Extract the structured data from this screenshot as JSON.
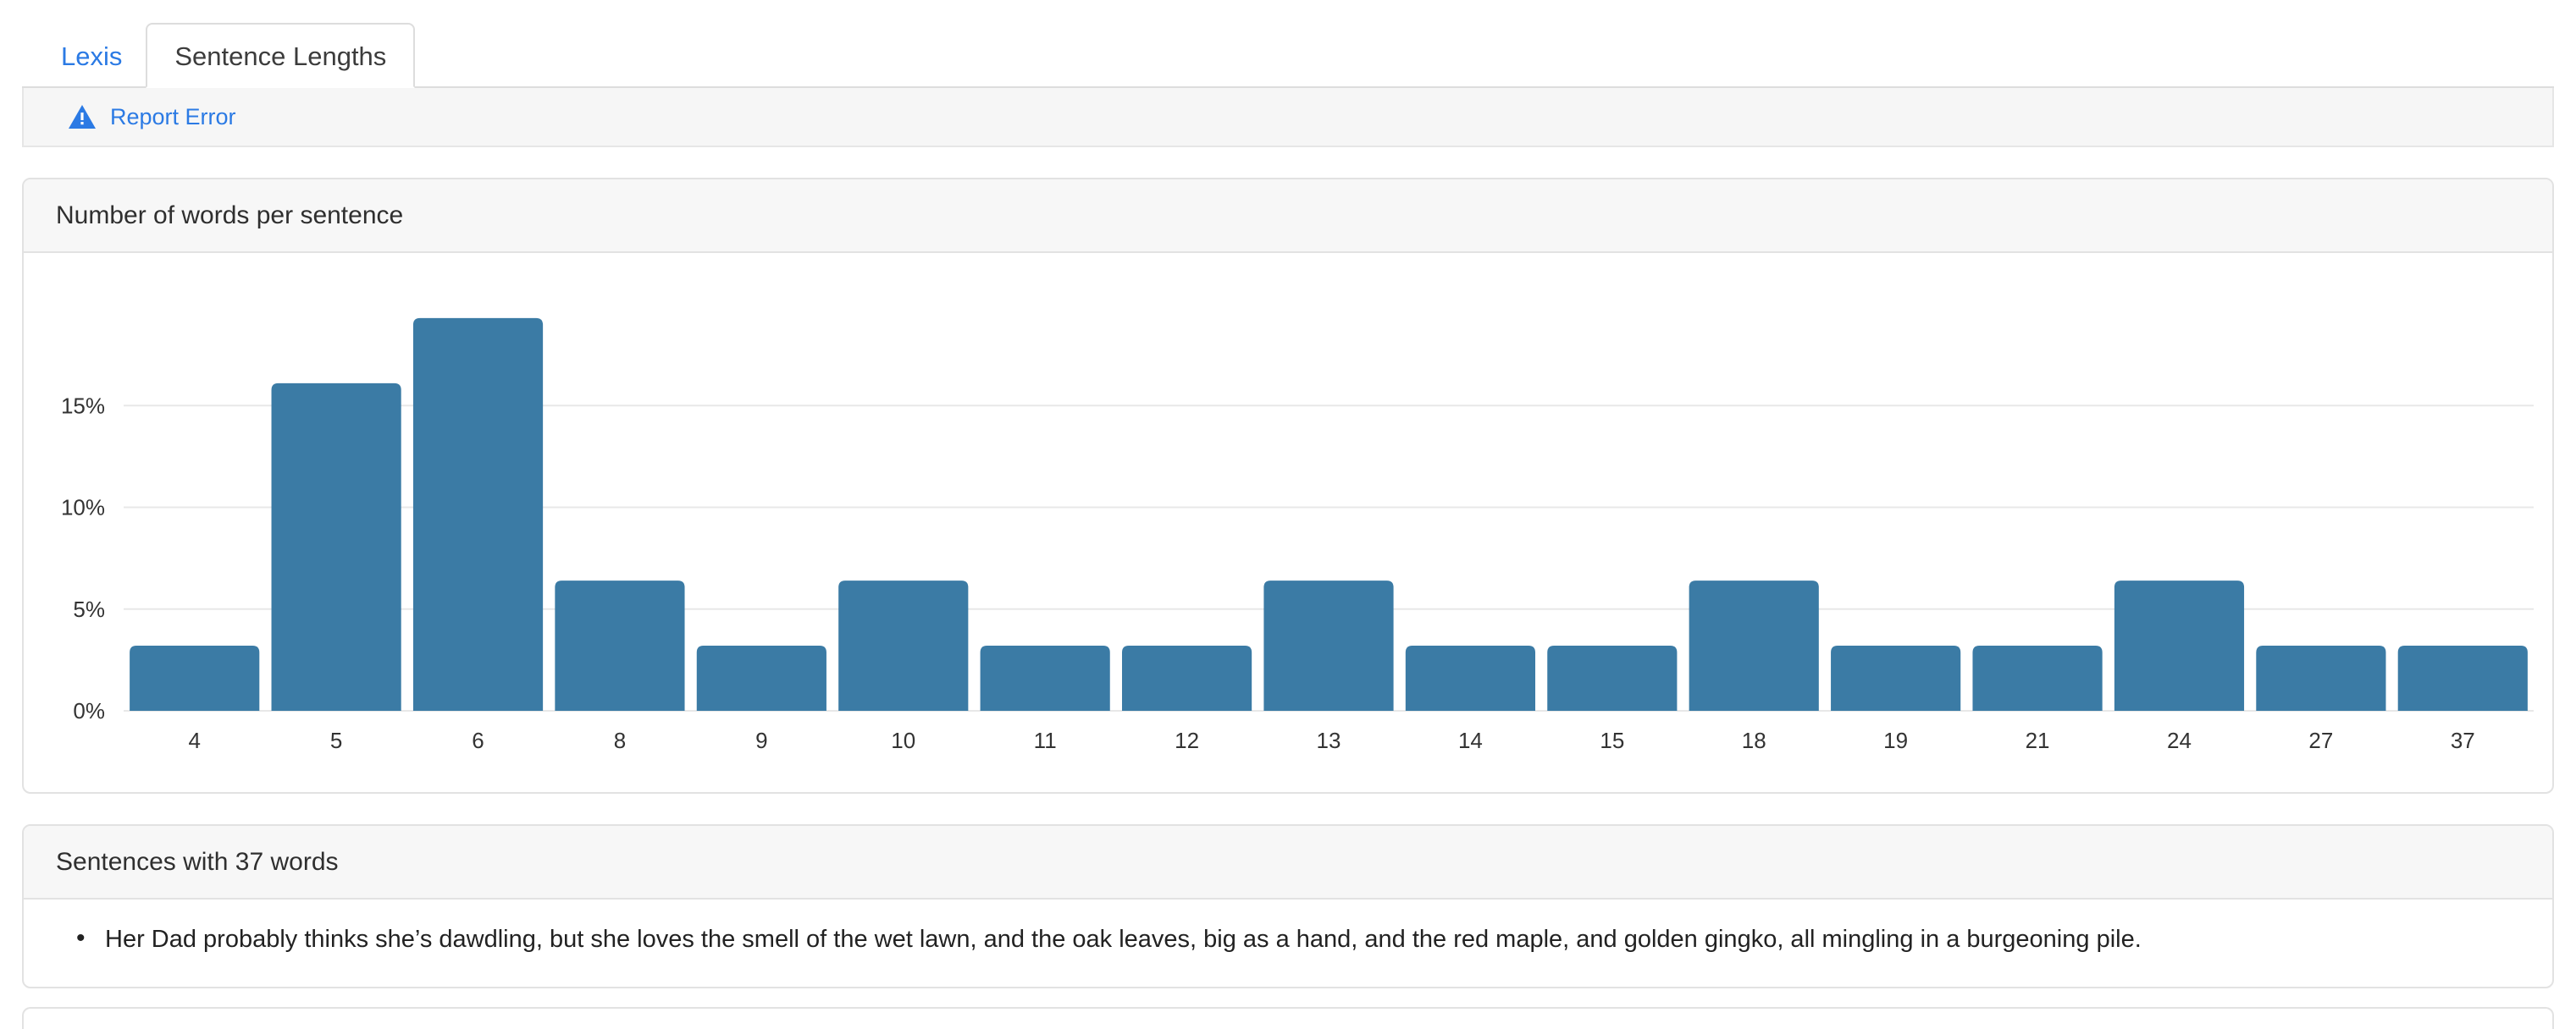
{
  "tabs": [
    {
      "label": "Lexis",
      "active": false
    },
    {
      "label": "Sentence Lengths",
      "active": true
    }
  ],
  "toolbar": {
    "report_error_label": "Report Error",
    "warning_icon": "warning-triangle-icon",
    "link_color": "#2b7ae4"
  },
  "chart_panel": {
    "title": "Number of words per sentence"
  },
  "sentences_panel": {
    "title": "Sentences with 37 words",
    "items": [
      "Her Dad probably thinks she’s dawdling, but she loves the smell of the wet lawn, and the oak leaves, big as a hand, and the red maple, and golden gingko, all mingling in a burgeoning pile."
    ]
  },
  "chart_data": {
    "type": "bar",
    "title": "Number of words per sentence",
    "xlabel": "",
    "ylabel": "",
    "categories": [
      "4",
      "5",
      "6",
      "8",
      "9",
      "10",
      "11",
      "12",
      "13",
      "14",
      "15",
      "18",
      "19",
      "21",
      "24",
      "27",
      "37"
    ],
    "values": [
      3.2,
      16.1,
      19.3,
      6.4,
      3.2,
      6.4,
      3.2,
      3.2,
      6.4,
      3.2,
      3.2,
      6.4,
      3.2,
      3.2,
      6.4,
      3.2,
      3.2
    ],
    "value_suffix": "%",
    "ylim": [
      0,
      21.5
    ],
    "yticks": [
      0,
      5,
      10,
      15
    ],
    "ytick_labels": [
      "0%",
      "5%",
      "10%",
      "15%"
    ],
    "grid": true,
    "legend": false,
    "bar_color": "#3b7ba5",
    "gridline_color": "#e8e8e8",
    "axis_text_color": "#333333"
  }
}
